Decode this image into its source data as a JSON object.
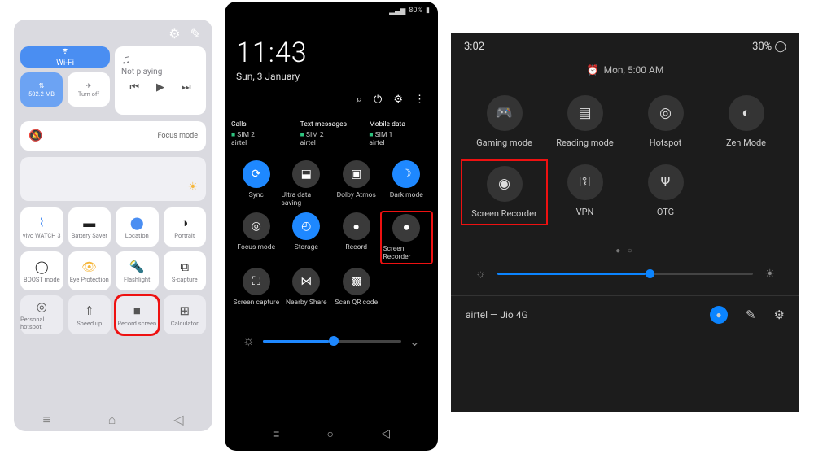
{
  "phone1": {
    "wifi_label": "Wi-Fi",
    "data_usage": "502.2 MB",
    "airplane_label": "Turn off",
    "music_status": "Not playing",
    "focus_mode": "Focus mode",
    "tiles_row1": [
      {
        "icon": "bluetooth",
        "label": "vivo WATCH 3"
      },
      {
        "icon": "battery",
        "label": "Battery Saver"
      },
      {
        "icon": "location",
        "label": "Location"
      },
      {
        "icon": "portrait",
        "label": "Portrait"
      }
    ],
    "tiles_row2": [
      {
        "icon": "boost",
        "label": "BOOST mode"
      },
      {
        "icon": "eye",
        "label": "Eye Protection"
      },
      {
        "icon": "flashlight",
        "label": "Flashlight"
      },
      {
        "icon": "scapture",
        "label": "S-capture"
      }
    ],
    "tiles_row3": [
      {
        "icon": "hotspot",
        "label": "Personal hotspot"
      },
      {
        "icon": "speedup",
        "label": "Speed up"
      },
      {
        "icon": "record",
        "label": "Record screen"
      },
      {
        "icon": "calc",
        "label": "Calculator"
      }
    ]
  },
  "phone2": {
    "battery": "80%",
    "time": "11:43",
    "date": "Sun, 3 January",
    "sims": [
      {
        "hdr": "Calls",
        "line1": "SIM 2",
        "line2": "airtel"
      },
      {
        "hdr": "Text messages",
        "line1": "SIM 2",
        "line2": "airtel"
      },
      {
        "hdr": "Mobile data",
        "line1": "SIM 1",
        "line2": "airtel"
      }
    ],
    "tiles": [
      {
        "label": "Sync",
        "on": true
      },
      {
        "label": "Ultra data saving",
        "on": false
      },
      {
        "label": "Dolby Atmos",
        "on": false
      },
      {
        "label": "Dark mode",
        "on": true
      },
      {
        "label": "Focus mode",
        "on": false
      },
      {
        "label": "Storage",
        "on": true
      },
      {
        "label": "Record",
        "on": false
      },
      {
        "label": "Screen Recorder",
        "on": false,
        "hl": true
      },
      {
        "label": "Screen capture",
        "on": false
      },
      {
        "label": "Nearby Share",
        "on": false
      },
      {
        "label": "Scan QR code",
        "on": false
      }
    ]
  },
  "phone3": {
    "time": "3:02",
    "battery": "30%",
    "alarm": "Mon, 5:00 AM",
    "tiles": [
      {
        "label": "Gaming mode"
      },
      {
        "label": "Reading mode"
      },
      {
        "label": "Hotspot"
      },
      {
        "label": "Zen Mode"
      },
      {
        "label": "Screen Recorder",
        "hl": true
      },
      {
        "label": "VPN"
      },
      {
        "label": "OTG"
      }
    ],
    "carrier": "airtel — Jio 4G"
  }
}
